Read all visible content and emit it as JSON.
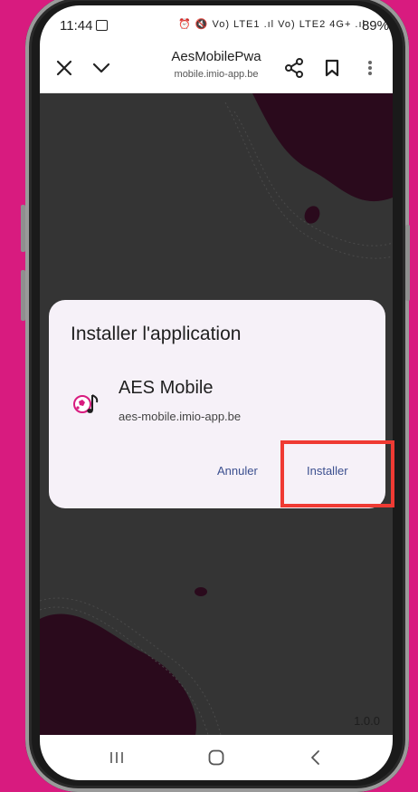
{
  "status_bar": {
    "time": "11:44",
    "signal_icons": "⏰ 🔇 Vo) LTE1 .ıl Vo) LTE2 4G+ .ıl",
    "battery": "89%"
  },
  "toolbar": {
    "title": "AesMobilePwa",
    "url": "mobile.imio-app.be"
  },
  "dialog": {
    "title": "Installer l'application",
    "app_name": "AES Mobile",
    "app_url": "aes-mobile.imio-app.be",
    "cancel_label": "Annuler",
    "install_label": "Installer"
  },
  "page": {
    "version": "1.0.0"
  },
  "colors": {
    "background": "#d81b7f",
    "page_background": "#343434",
    "blob": "#2a0a1c",
    "dialog": "#f6f1f8",
    "button_text": "#3b4f8f",
    "highlight": "#ef3a33"
  }
}
